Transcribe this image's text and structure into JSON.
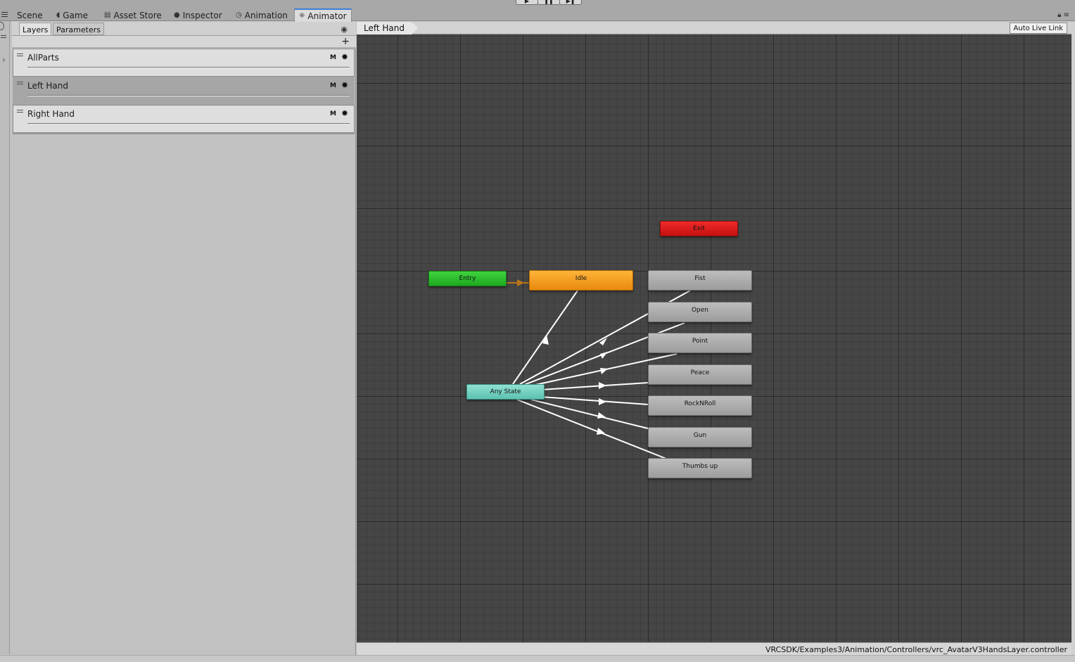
{
  "tabs": [
    {
      "label": "Scene",
      "icon": "menu-icon"
    },
    {
      "label": "Game",
      "icon": "game-icon"
    },
    {
      "label": "Asset Store",
      "icon": "store-icon"
    },
    {
      "label": "Inspector",
      "icon": "info-icon"
    },
    {
      "label": "Animation",
      "icon": "clock-icon"
    },
    {
      "label": "Animator",
      "icon": "animator-icon",
      "active": true
    }
  ],
  "play_controls": [
    "play",
    "pause",
    "step"
  ],
  "left_panel": {
    "tabs": [
      "Layers",
      "Parameters"
    ],
    "active_tab": "Layers",
    "add_label": "+",
    "layers": [
      {
        "name": "AllParts",
        "badge": "M",
        "selected": false
      },
      {
        "name": "Left Hand",
        "badge": "M",
        "selected": true
      },
      {
        "name": "Right Hand",
        "badge": "M",
        "selected": false
      }
    ]
  },
  "graph": {
    "breadcrumb": "Left Hand",
    "auto_live_link": "Auto Live Link",
    "states": {
      "entry": "Entry",
      "exit": "Exit",
      "any_state": "Any State",
      "idle": "Idle",
      "fist": "Fist",
      "open": "Open",
      "point": "Point",
      "peace": "Peace",
      "rocknroll": "RockNRoll",
      "gun": "Gun",
      "thumbs_up": "Thumbs up"
    },
    "colors": {
      "entry": "#27c127",
      "exit": "#dd1b1b",
      "any_state": "#74d2c2",
      "default_state": "#f59f24",
      "state": "#aeaeae",
      "transition": "#ffffff",
      "default_transition": "#b8741a"
    }
  },
  "status_path": "VRCSDK/Examples3/Animation/Controllers/vrc_AvatarV3HandsLayer.controller"
}
